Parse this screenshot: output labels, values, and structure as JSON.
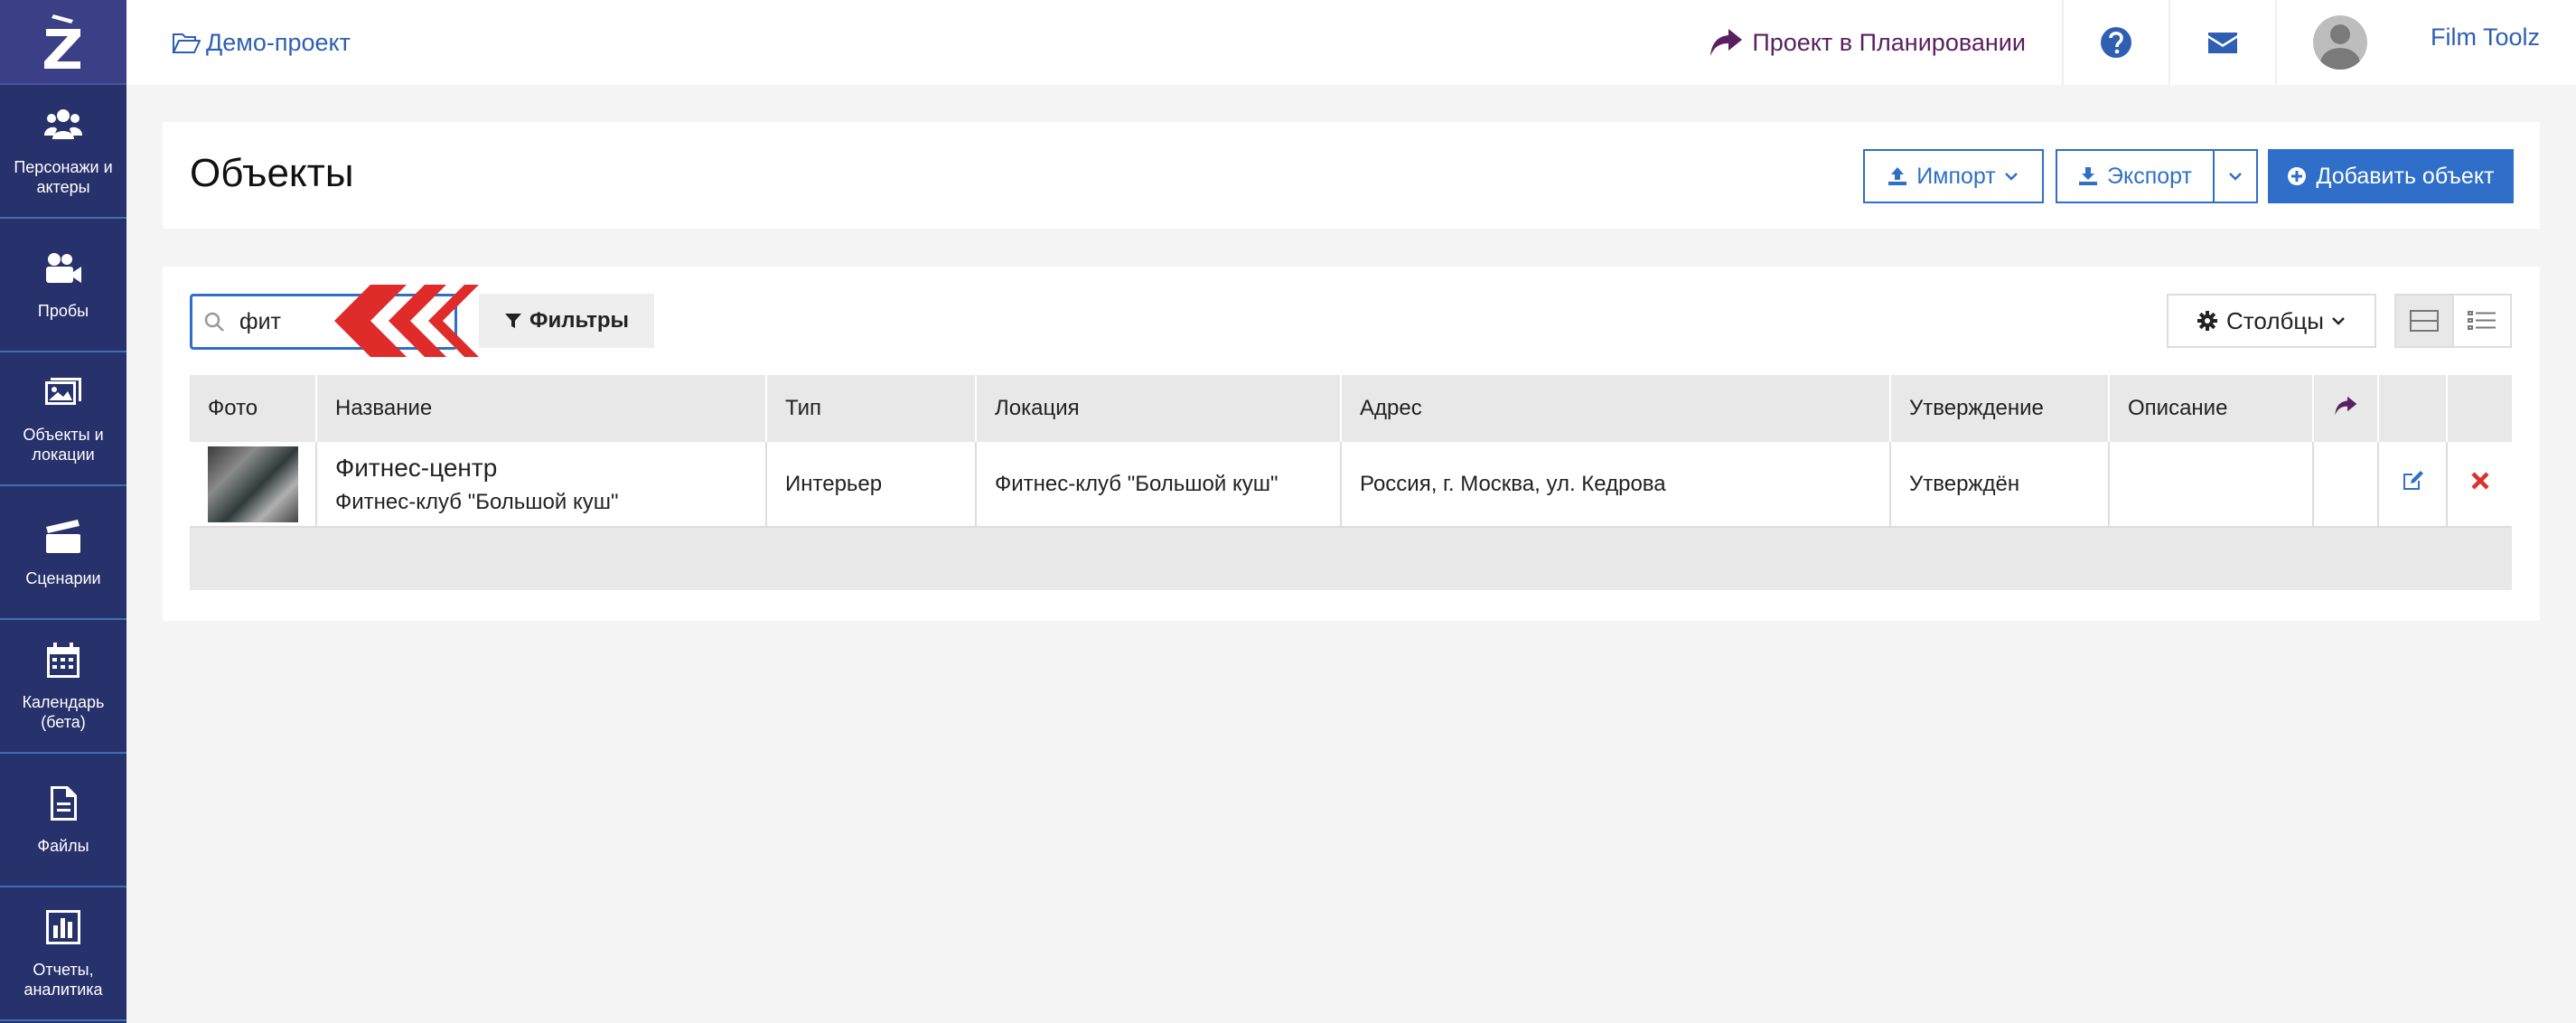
{
  "sidebar": {
    "logo": "Z",
    "items": [
      {
        "label": "Персонажи и\nактеры",
        "icon": "users-icon"
      },
      {
        "label": "Пробы",
        "icon": "video-camera-icon"
      },
      {
        "label": "Объекты и\nлокации",
        "icon": "image-icon"
      },
      {
        "label": "Сценарии",
        "icon": "clapperboard-icon"
      },
      {
        "label": "Календарь\n(бета)",
        "icon": "calendar-icon"
      },
      {
        "label": "Файлы",
        "icon": "file-icon"
      },
      {
        "label": "Отчеты,\nаналитика",
        "icon": "bar-chart-icon"
      }
    ]
  },
  "header": {
    "project": "Демо-проект",
    "status": "Проект в Планировании",
    "username": "Film Toolz"
  },
  "page": {
    "title": "Объекты",
    "import_label": "Импорт",
    "export_label": "Экспорт",
    "add_label": "Добавить объект"
  },
  "toolbar": {
    "search_value": "фит",
    "filters_label": "Фильтры",
    "columns_label": "Столбцы"
  },
  "table": {
    "headers": [
      "Фото",
      "Название",
      "Тип",
      "Локация",
      "Адрес",
      "Утверждение",
      "Описание"
    ],
    "rows": [
      {
        "name": "Фитнес-центр",
        "subname": "Фитнес-клуб \"Большой куш\"",
        "type": "Интерьер",
        "location": "Фитнес-клуб \"Большой куш\"",
        "address": "Россия, г. Москва, ул. Кедрова",
        "approval": "Утверждён",
        "description": ""
      }
    ]
  },
  "colors": {
    "sidebar": "#27316b",
    "primary": "#2f6fc9",
    "status": "#5a1f60",
    "delete": "#d9342b",
    "arrows": "#e02b2b"
  }
}
